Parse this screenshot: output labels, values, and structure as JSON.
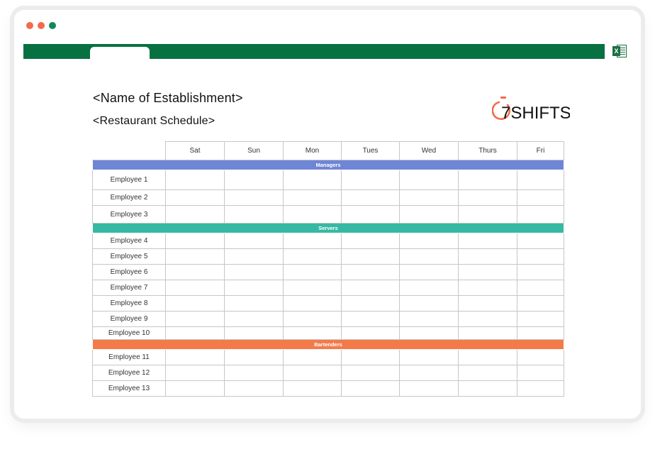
{
  "window": {
    "excel_icon_letter": "X"
  },
  "document": {
    "title": "<Name of Establishment>",
    "subtitle": "<Restaurant Schedule>",
    "logo_text": "7SHIFTS"
  },
  "schedule": {
    "days": [
      "Sat",
      "Sun",
      "Mon",
      "Tues",
      "Wed",
      "Thurs",
      "Fri"
    ],
    "sections": [
      {
        "label": "Managers",
        "color": "#6f85d6",
        "employees": [
          "Employee 1",
          "Employee 2",
          "Employee 3"
        ]
      },
      {
        "label": "Servers",
        "color": "#36b9a3",
        "employees": [
          "Employee 4",
          "Employee 5",
          "Employee 6",
          "Employee 7",
          "Employee 8",
          "Employee 9",
          "Employee 10"
        ]
      },
      {
        "label": "Bartenders",
        "color": "#f47a4a",
        "employees": [
          "Employee 11",
          "Employee 12",
          "Employee 13"
        ]
      }
    ]
  },
  "colors": {
    "ribbon": "#077141",
    "accent_orange": "#f26b4a",
    "logo_dark": "#111111"
  }
}
